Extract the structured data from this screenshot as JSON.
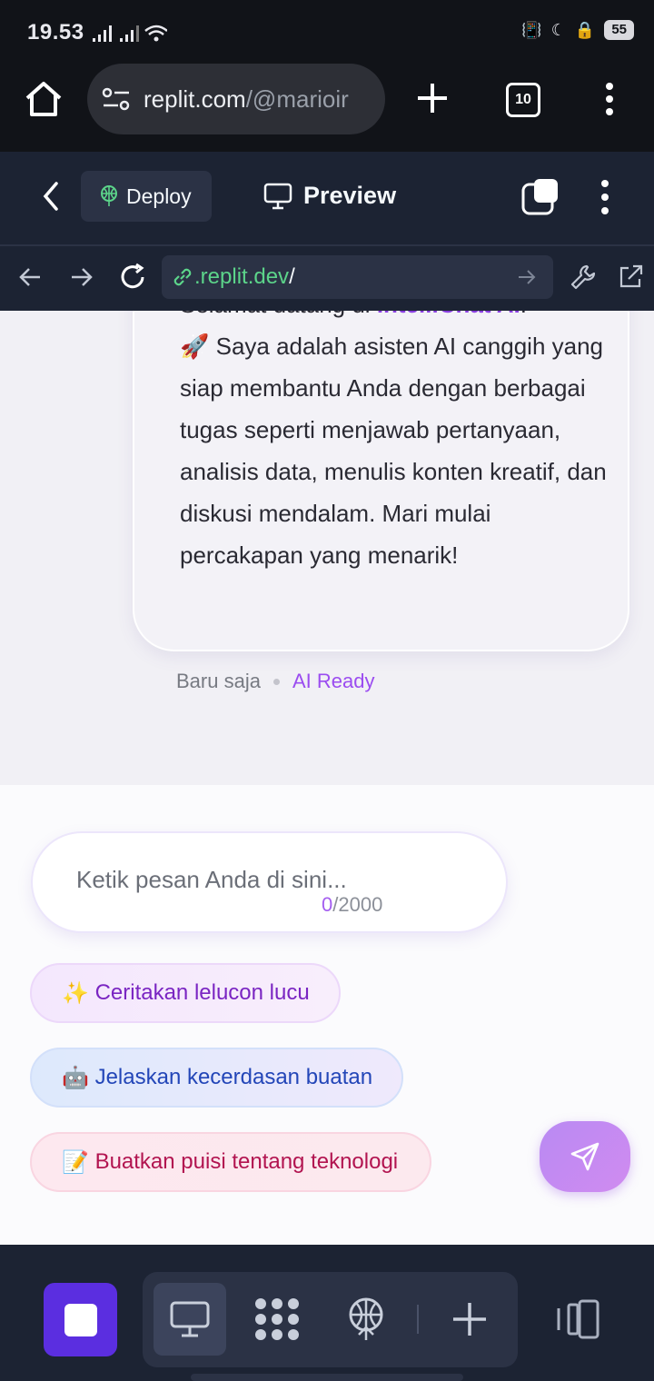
{
  "status_bar": {
    "time": "19.53",
    "battery": "55"
  },
  "browser": {
    "url_host": "replit.com",
    "url_path": "/@marioir",
    "tab_count": "10"
  },
  "replit_header": {
    "deploy_label": "Deploy",
    "preview_label": "Preview"
  },
  "webview_bar": {
    "url_domain": ".replit.dev",
    "url_path": "/"
  },
  "chat": {
    "welcome_prefix": "Selamat datang di ",
    "brand": "IntelliChat AI",
    "welcome_suffix": "!",
    "message_emoji": "🚀",
    "message_body": " Saya adalah asisten AI canggih yang siap membantu Anda dengan berbagai tugas seperti menjawab pertanyaan, analisis data, menulis konten kreatif, dan diskusi mendalam. Mari mulai percakapan yang menarik!",
    "timestamp": "Baru saja",
    "status": "AI Ready"
  },
  "composer": {
    "placeholder": "Ketik pesan Anda di sini...",
    "char_count": "0",
    "char_limit": "/2000"
  },
  "suggestions": [
    {
      "emoji": "✨",
      "label": "Ceritakan lelucon lucu"
    },
    {
      "emoji": "🤖",
      "label": "Jelaskan kecerdasan buatan"
    },
    {
      "emoji": "📝",
      "label": "Buatkan puisi tentang teknologi"
    }
  ],
  "colors": {
    "brand_purple": "#8a3fe0",
    "replit_bg": "#1c2333",
    "stop_button": "#5b2ee0",
    "url_green": "#5cd48a"
  },
  "icons": {
    "home": "home-icon",
    "site_settings": "tune-icon",
    "new_tab": "plus-icon",
    "menu": "kebab-menu-icon",
    "back": "chevron-left-icon",
    "deploy": "deploy-icon",
    "preview": "monitor-icon",
    "send": "paper-plane-icon"
  }
}
